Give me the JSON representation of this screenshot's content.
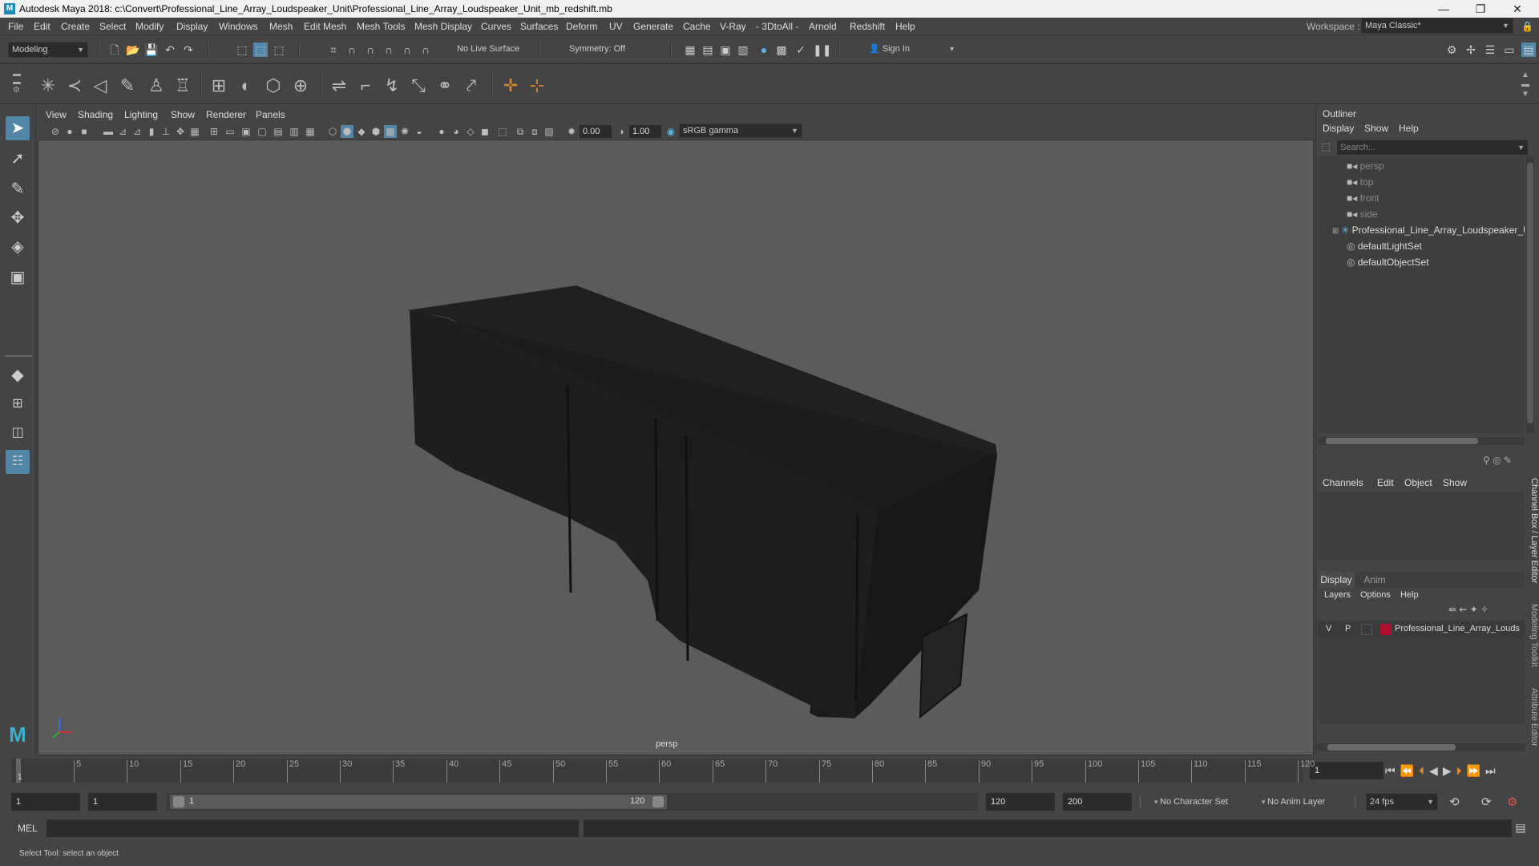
{
  "window": {
    "app_icon": "M",
    "title": "Autodesk Maya 2018: c:\\Convert\\Professional_Line_Array_Loudspeaker_Unit\\Professional_Line_Array_Loudspeaker_Unit_mb_redshift.mb",
    "min": "—",
    "max": "❐",
    "close": "✕"
  },
  "menubar": {
    "items": [
      "File",
      "Edit",
      "Create",
      "Select",
      "Modify",
      "Display",
      "Windows",
      "Mesh",
      "Edit Mesh",
      "Mesh Tools",
      "Mesh Display",
      "Curves",
      "Surfaces",
      "Deform",
      "UV",
      "Generate",
      "Cache",
      "V-Ray",
      "- 3DtoAll -",
      "Arnold",
      "Redshift",
      "Help"
    ],
    "workspace_label": "Workspace :",
    "workspace_value": "Maya Classic*"
  },
  "statusline": {
    "mode": "Modeling",
    "live_surface": "No Live Surface",
    "symmetry": "Symmetry: Off",
    "sign_in": "Sign In"
  },
  "viewport": {
    "menus": [
      "View",
      "Shading",
      "Lighting",
      "Show",
      "Renderer",
      "Panels"
    ],
    "exposure": "0.00",
    "gamma": "1.00",
    "color_space": "sRGB gamma",
    "camera_label": "persp"
  },
  "outliner": {
    "title": "Outliner",
    "menus": [
      "Display",
      "Show",
      "Help"
    ],
    "search_placeholder": "Search...",
    "items": [
      {
        "name": "persp",
        "icon": "camera-icon",
        "dim": true
      },
      {
        "name": "top",
        "icon": "camera-icon",
        "dim": true
      },
      {
        "name": "front",
        "icon": "camera-icon",
        "dim": true
      },
      {
        "name": "side",
        "icon": "camera-icon",
        "dim": true
      },
      {
        "name": "Professional_Line_Array_Loudspeaker_U",
        "icon": "group-icon",
        "dim": false
      },
      {
        "name": "defaultLightSet",
        "icon": "set-icon",
        "dim": false
      },
      {
        "name": "defaultObjectSet",
        "icon": "set-icon",
        "dim": false
      }
    ]
  },
  "channelbox": {
    "menus": [
      "Channels",
      "Edit",
      "Object",
      "Show"
    ],
    "side_tab": "Channel Box / Layer Editor"
  },
  "layers": {
    "tabs": [
      "Display",
      "Anim"
    ],
    "menus": [
      "Layers",
      "Options",
      "Help"
    ],
    "row": {
      "v": "V",
      "p": "P",
      "name": "Professional_Line_Array_Louds",
      "color": "#b01030"
    }
  },
  "side_tabs": {
    "modeling_toolkit": "Modeling Toolkit",
    "attribute_editor": "Attribute Editor"
  },
  "timeline": {
    "ticks": [
      "5",
      "10",
      "15",
      "20",
      "25",
      "30",
      "35",
      "40",
      "45",
      "50",
      "55",
      "60",
      "65",
      "70",
      "75",
      "80",
      "85",
      "90",
      "95",
      "100",
      "105",
      "110",
      "115",
      "120"
    ],
    "start_marker": "1",
    "current_frame": "1"
  },
  "range": {
    "start": "1",
    "playback_start": "1",
    "slider_start": "1",
    "slider_end": "120",
    "playback_end": "120",
    "end": "200",
    "character_set": "No Character Set",
    "anim_layer": "No Anim Layer",
    "fps": "24 fps"
  },
  "cmdline": {
    "label": "MEL"
  },
  "helpline": {
    "text": "Select Tool: select an object"
  },
  "colors": {
    "accent": "#5285a6",
    "panel": "#444444",
    "viewport_bg": "#5a5a5a",
    "field": "#2b2b2b"
  }
}
